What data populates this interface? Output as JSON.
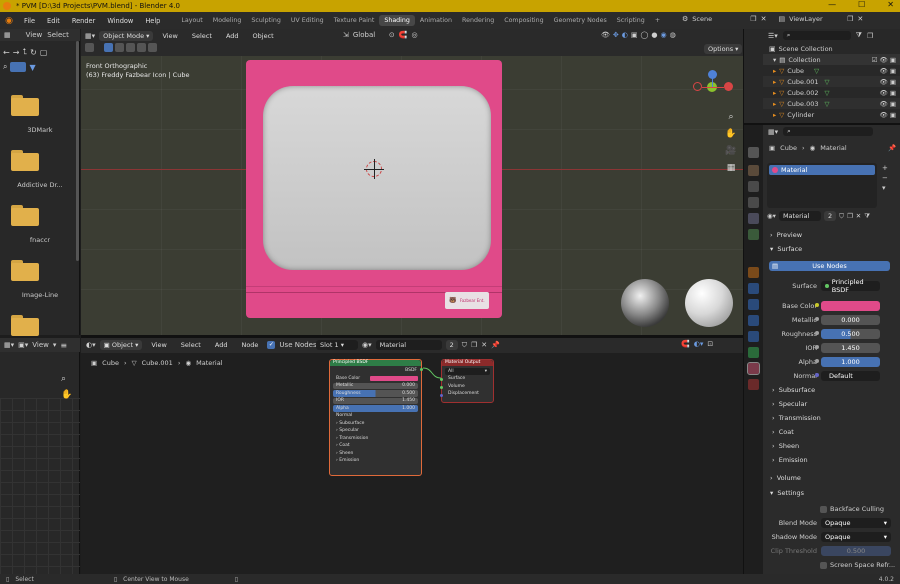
{
  "window": {
    "title": "* PVM [D:\\3d Projects\\PVM.blend] - Blender 4.0",
    "min_glyph": "—",
    "max_glyph": "☐",
    "close_glyph": "✕"
  },
  "menu": [
    "File",
    "Edit",
    "Render",
    "Window",
    "Help"
  ],
  "workspaces": [
    {
      "label": "Layout",
      "active": false
    },
    {
      "label": "Modeling",
      "active": false
    },
    {
      "label": "Sculpting",
      "active": false
    },
    {
      "label": "UV Editing",
      "active": false
    },
    {
      "label": "Texture Paint",
      "active": false
    },
    {
      "label": "Shading",
      "active": true
    },
    {
      "label": "Animation",
      "active": false
    },
    {
      "label": "Rendering",
      "active": false
    },
    {
      "label": "Compositing",
      "active": false
    },
    {
      "label": "Geometry Nodes",
      "active": false
    },
    {
      "label": "Scripting",
      "active": false
    }
  ],
  "add_workspace": "+",
  "scene": "Scene",
  "viewlayer": "ViewLayer",
  "filebrowser": {
    "view": "View",
    "select": "Select",
    "folders": [
      "3DMark",
      "Addictive Dr...",
      "fnaccr",
      "Image-Line",
      ""
    ]
  },
  "viewport": {
    "mode": "Object Mode",
    "menus": [
      "View",
      "Select",
      "Add",
      "Object"
    ],
    "transform": "Global",
    "options": "Options",
    "view_name": "Front Orthographic",
    "object_info": "(63) Freddy Fazbear Icon | Cube",
    "sticker_text": "Fazbear Ent."
  },
  "node_editor": {
    "object_type": "Object",
    "menus": [
      "View",
      "Select",
      "Add",
      "Node"
    ],
    "use_nodes": "Use Nodes",
    "slot": "Slot 1",
    "material": "Material",
    "users": "2",
    "breadcrumb": [
      "Cube",
      "Cube.001",
      "Material"
    ],
    "bsdf": {
      "title": "Principled BSDF",
      "output": "BSDF",
      "rows": [
        "Base Color",
        "Metallic",
        "Roughness",
        "IOR",
        "Alpha"
      ],
      "values": [
        "",
        "0.000",
        "0.500",
        "1.450",
        "1.000"
      ],
      "normal": "Normal",
      "subpanels": [
        "Subsurface",
        "Specular",
        "Transmission",
        "Coat",
        "Sheen",
        "Emission"
      ]
    },
    "output_node": {
      "title": "Material Output",
      "target": "All",
      "sockets": [
        "Surface",
        "Volume",
        "Displacement"
      ]
    }
  },
  "leftpanel": {
    "view": "View"
  },
  "outliner": {
    "header": "Scene Collection",
    "items": [
      {
        "label": "Collection",
        "level": 1
      },
      {
        "label": "Cube",
        "level": 2
      },
      {
        "label": "Cube.001",
        "level": 2
      },
      {
        "label": "Cube.002",
        "level": 2
      },
      {
        "label": "Cube.003",
        "level": 2
      },
      {
        "label": "Cylinder",
        "level": 2
      }
    ]
  },
  "properties": {
    "breadcrumb": [
      "Cube",
      "Material"
    ],
    "slot_item": "Material",
    "material_name": "Material",
    "material_users": "2",
    "sections": {
      "preview": "Preview",
      "surface": "Surface",
      "volume": "Volume",
      "settings": "Settings"
    },
    "use_nodes": "Use Nodes",
    "surface_label": "Surface",
    "surface_value": "Principled BSDF",
    "params": [
      {
        "label": "Base Color",
        "value": "",
        "kind": "color"
      },
      {
        "label": "Metallic",
        "value": "0.000",
        "kind": "num"
      },
      {
        "label": "Roughness",
        "value": "0.500",
        "kind": "num"
      },
      {
        "label": "IOR",
        "value": "1.450",
        "kind": "num"
      },
      {
        "label": "Alpha",
        "value": "1.000",
        "kind": "num"
      },
      {
        "label": "Normal",
        "value": "Default",
        "kind": "text"
      }
    ],
    "subsections": [
      "Subsurface",
      "Specular",
      "Transmission",
      "Coat",
      "Sheen",
      "Emission"
    ],
    "backface": "Backface Culling",
    "blend_mode_label": "Blend Mode",
    "blend_mode": "Opaque",
    "shadow_mode_label": "Shadow Mode",
    "shadow_mode": "Opaque",
    "clip_label": "Clip Threshold",
    "clip_value": "0.500",
    "ssr": "Screen Space Refr..."
  },
  "status": {
    "left": "Select",
    "middle": "Center View to Mouse",
    "version": "4.0.2"
  },
  "colors": {
    "accent_blue": "#4772b3",
    "base_color": "#e04a89",
    "title_bar": "#c8a300"
  }
}
